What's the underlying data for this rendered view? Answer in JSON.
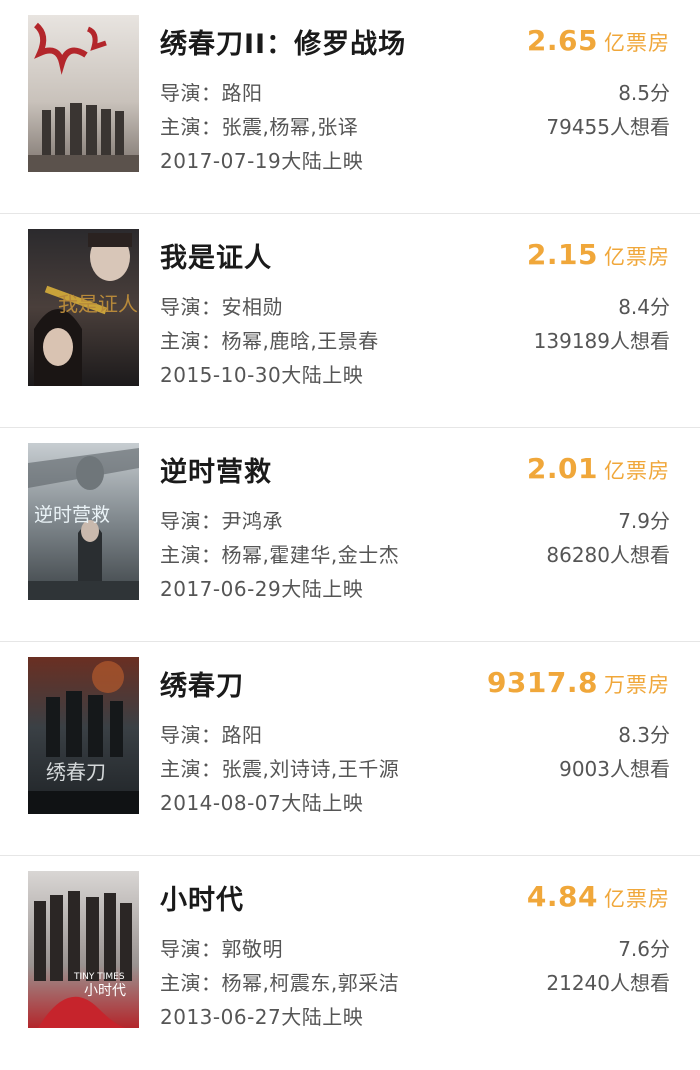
{
  "labels": {
    "director": "导演：",
    "cast": "主演："
  },
  "colors": {
    "accent": "#f0a73a",
    "text_primary": "#1a1a1a",
    "text_secondary": "#555555",
    "divider": "#e6e6e6"
  },
  "movies": [
    {
      "title": "绣春刀II：修罗战场",
      "director": "路阳",
      "cast": "张震,杨幂,张译",
      "release": "2017-07-19大陆上映",
      "box_office": "2.65",
      "box_unit": "亿票房",
      "score": "8.5分",
      "want": "79455人想看",
      "poster_icon": "poster-image"
    },
    {
      "title": "我是证人",
      "director": "安相勋",
      "cast": "杨幂,鹿晗,王景春",
      "release": "2015-10-30大陆上映",
      "box_office": "2.15",
      "box_unit": "亿票房",
      "score": "8.4分",
      "want": "139189人想看",
      "poster_icon": "poster-image"
    },
    {
      "title": "逆时营救",
      "director": "尹鸿承",
      "cast": "杨幂,霍建华,金士杰",
      "release": "2017-06-29大陆上映",
      "box_office": "2.01",
      "box_unit": "亿票房",
      "score": "7.9分",
      "want": "86280人想看",
      "poster_icon": "poster-image"
    },
    {
      "title": "绣春刀",
      "director": "路阳",
      "cast": "张震,刘诗诗,王千源",
      "release": "2014-08-07大陆上映",
      "box_office": "9317.8",
      "box_unit": "万票房",
      "score": "8.3分",
      "want": "9003人想看",
      "poster_icon": "poster-image"
    },
    {
      "title": "小时代",
      "director": "郭敬明",
      "cast": "杨幂,柯震东,郭采洁",
      "release": "2013-06-27大陆上映",
      "box_office": "4.84",
      "box_unit": "亿票房",
      "score": "7.6分",
      "want": "21240人想看",
      "poster_icon": "poster-image"
    }
  ]
}
